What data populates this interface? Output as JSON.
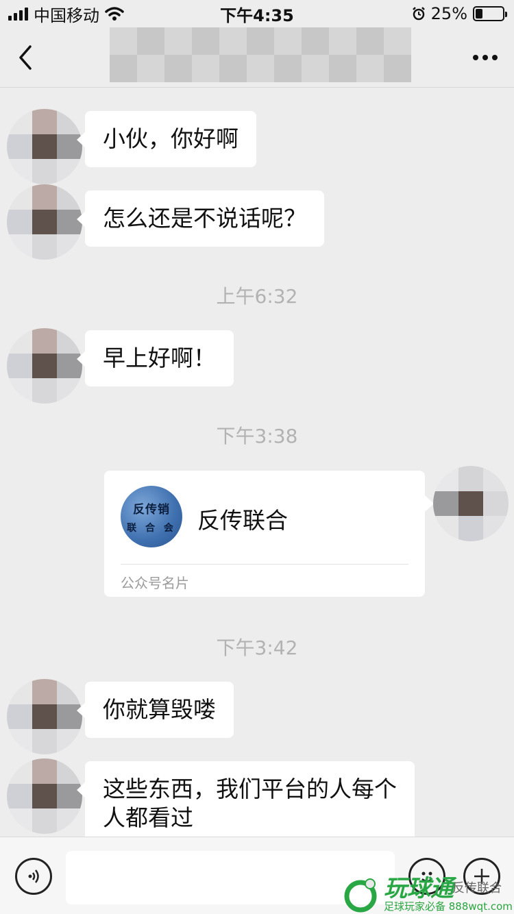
{
  "status_bar": {
    "carrier": "中国移动",
    "time": "下午4:35",
    "battery_text": "25%",
    "battery_level": 0.25
  },
  "nav": {
    "title": "",
    "back_icon": "chevron-left-icon",
    "more_icon": "more-dots-icon"
  },
  "messages": [
    {
      "text": "小伙，你好啊"
    },
    {
      "text": "怎么还是不说话呢？"
    },
    {
      "text": "早上好啊！"
    },
    {
      "text": "你就算毁喽"
    },
    {
      "text": "这些东西，我们平台的人每个人都看过",
      "line1": "这些东西，我们平台的人每个",
      "line2": "人都看过"
    }
  ],
  "timestamps": [
    "上午6:32",
    "下午3:38",
    "下午3:42"
  ],
  "card": {
    "logo_line1": "反传销",
    "logo_line2": "联 合 会",
    "name": "反传联合",
    "type_label": "公众号名片"
  },
  "bottom_bar": {
    "voice_icon": "voice-icon",
    "emoji_icon": "emoji-icon",
    "plus_icon": "plus-icon",
    "input_value": ""
  },
  "watermark": {
    "logo": "玩球通",
    "tagline": "足球玩家必备 888wqt.com",
    "side_text": "反传联合"
  },
  "colors": {
    "background": "#ededed",
    "bubble": "#ffffff",
    "timestamp": "#b2b2b2",
    "watermark_green": "#29a745"
  }
}
